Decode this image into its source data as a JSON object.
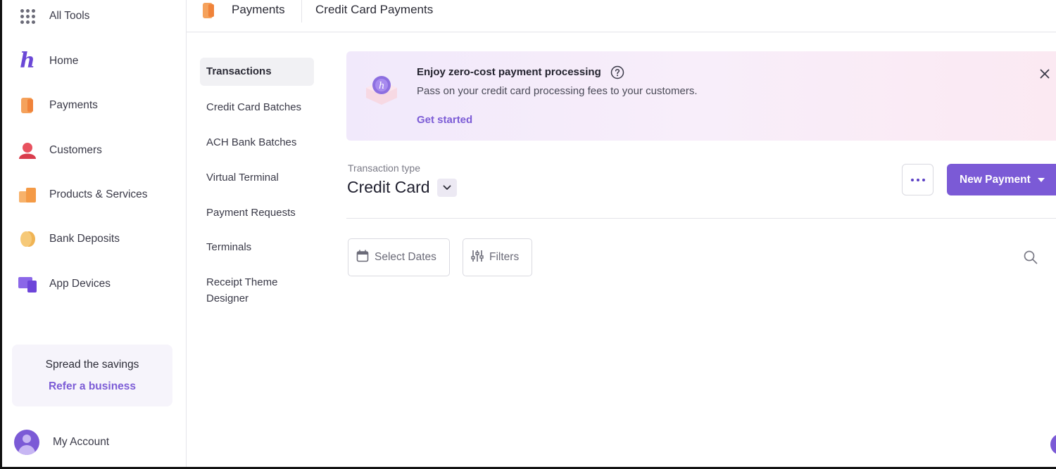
{
  "sidebar": {
    "items": [
      {
        "label": "All Tools",
        "icon": "grid-icon"
      },
      {
        "label": "Home",
        "icon": "home-logo-icon"
      },
      {
        "label": "Payments",
        "icon": "payments-icon"
      },
      {
        "label": "Customers",
        "icon": "customers-icon"
      },
      {
        "label": "Products & Services",
        "icon": "products-icon"
      },
      {
        "label": "Bank Deposits",
        "icon": "bank-deposits-icon"
      },
      {
        "label": "App Devices",
        "icon": "app-devices-icon"
      }
    ],
    "home_glyph": "h",
    "promo": {
      "title": "Spread the savings",
      "link": "Refer a business"
    },
    "account": {
      "label": "My Account"
    }
  },
  "topbar": {
    "section": "Payments",
    "page": "Credit Card Payments"
  },
  "subnav": {
    "items": [
      "Transactions",
      "Credit Card Batches",
      "ACH Bank Batches",
      "Virtual Terminal",
      "Payment Requests",
      "Terminals",
      "Receipt Theme Designer"
    ],
    "active_index": 0
  },
  "banner": {
    "title": "Enjoy zero-cost payment processing",
    "description": "Pass on your credit card processing fees to your customers.",
    "link": "Get started"
  },
  "transaction_type": {
    "label": "Transaction type",
    "value": "Credit Card"
  },
  "actions": {
    "new_payment": "New Payment"
  },
  "filters": {
    "select_dates": "Select Dates",
    "filters": "Filters"
  },
  "colors": {
    "accent": "#7b5ad6",
    "link": "#7c5cd6",
    "banner_start": "#f1e9fb",
    "banner_end": "#fbe9f2"
  }
}
